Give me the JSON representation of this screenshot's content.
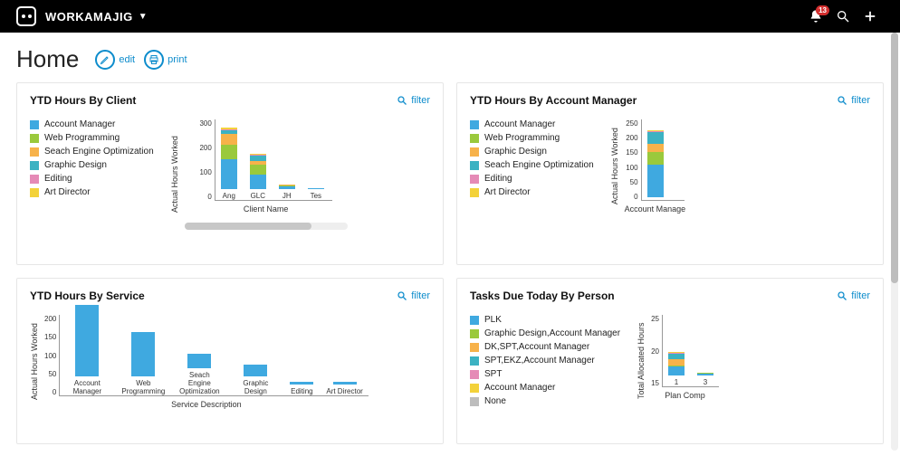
{
  "topbar": {
    "brand": "WORKAMAJIG",
    "notif_count": "13"
  },
  "page": {
    "title": "Home",
    "edit_label": "edit",
    "print_label": "print"
  },
  "filter_label": "filter",
  "colors": {
    "blue": "#3fa9e0",
    "green": "#9ac93c",
    "orange": "#f7b24a",
    "teal": "#3cb2c2",
    "pink": "#e58ab6",
    "yellow": "#f3d23a",
    "grey": "#bdbdbd"
  },
  "cards": {
    "ytd_client": {
      "title": "YTD Hours By Client",
      "y_title": "Actual Hours Worked",
      "x_title": "Client Name",
      "legend": [
        {
          "label": "Account Manager",
          "color": "blue"
        },
        {
          "label": "Web Programming",
          "color": "green"
        },
        {
          "label": "Seach Engine Optimization",
          "color": "orange"
        },
        {
          "label": "Graphic Design",
          "color": "teal"
        },
        {
          "label": "Editing",
          "color": "pink"
        },
        {
          "label": "Art Director",
          "color": "yellow"
        }
      ],
      "chart_data": {
        "type": "bar",
        "categories": [
          "Ang",
          "GLC",
          "JH",
          "Tes"
        ],
        "ylim": [
          0,
          300
        ],
        "ticks": [
          "300",
          "200",
          "100",
          "0"
        ],
        "series": [
          {
            "name": "Account Manager",
            "color": "blue",
            "values": [
              110,
              55,
              10,
              2
            ]
          },
          {
            "name": "Web Programming",
            "color": "green",
            "values": [
              55,
              35,
              5,
              0
            ]
          },
          {
            "name": "Seach Engine Optimization",
            "color": "orange",
            "values": [
              40,
              15,
              2,
              0
            ]
          },
          {
            "name": "Graphic Design",
            "color": "teal",
            "values": [
              12,
              20,
              0,
              0
            ]
          },
          {
            "name": "Editing",
            "color": "pink",
            "values": [
              2,
              2,
              0,
              0
            ]
          },
          {
            "name": "Art Director",
            "color": "yellow",
            "values": [
              8,
              2,
              0,
              0
            ]
          }
        ]
      }
    },
    "ytd_manager": {
      "title": "YTD Hours By Account Manager",
      "y_title": "Actual Hours Worked",
      "x_title": "Account Manage",
      "legend": [
        {
          "label": "Account Manager",
          "color": "blue"
        },
        {
          "label": "Web Programming",
          "color": "green"
        },
        {
          "label": "Graphic Design",
          "color": "orange"
        },
        {
          "label": "Seach Engine Optimization",
          "color": "teal"
        },
        {
          "label": "Editing",
          "color": "pink"
        },
        {
          "label": "Art Director",
          "color": "yellow"
        }
      ],
      "chart_data": {
        "type": "bar",
        "categories": [
          ""
        ],
        "ylim": [
          0,
          250
        ],
        "ticks": [
          "250",
          "200",
          "150",
          "100",
          "50",
          "0"
        ],
        "series": [
          {
            "name": "Account Manager",
            "color": "blue",
            "values": [
              100
            ]
          },
          {
            "name": "Web Programming",
            "color": "green",
            "values": [
              40
            ]
          },
          {
            "name": "Graphic Design",
            "color": "orange",
            "values": [
              25
            ]
          },
          {
            "name": "Seach Engine Optimization",
            "color": "teal",
            "values": [
              35
            ]
          },
          {
            "name": "Editing",
            "color": "pink",
            "values": [
              2
            ]
          },
          {
            "name": "Art Director",
            "color": "yellow",
            "values": [
              5
            ]
          }
        ]
      }
    },
    "ytd_service": {
      "title": "YTD Hours By Service",
      "y_title": "Actual Hours Worked",
      "x_title": "Service Description",
      "chart_data": {
        "type": "bar",
        "categories": [
          "Account Manager",
          "Web Programming",
          "Seach Engine Optimization",
          "Graphic Design",
          "Editing",
          "Art Director"
        ],
        "ylim": [
          0,
          200
        ],
        "ticks": [
          "200",
          "150",
          "100",
          "50",
          "0"
        ],
        "values": [
          175,
          108,
          35,
          30,
          6,
          6
        ]
      }
    },
    "tasks_due": {
      "title": "Tasks Due Today By Person",
      "y_title": "Total Allocated Hours",
      "x_title": "Plan Comp",
      "legend": [
        {
          "label": "PLK",
          "color": "blue"
        },
        {
          "label": "Graphic Design,Account Manager",
          "color": "green"
        },
        {
          "label": "DK,SPT,Account Manager",
          "color": "orange"
        },
        {
          "label": "SPT,EKZ,Account Manager",
          "color": "teal"
        },
        {
          "label": "SPT",
          "color": "pink"
        },
        {
          "label": "Account Manager",
          "color": "yellow"
        },
        {
          "label": "None",
          "color": "grey"
        }
      ],
      "chart_data": {
        "type": "bar",
        "categories": [
          "1",
          "3"
        ],
        "ylim": [
          0,
          25
        ],
        "ticks": [
          "25",
          "20",
          "15"
        ],
        "series": [
          {
            "name": "PLK",
            "color": "blue",
            "values": [
              3,
              0.5
            ]
          },
          {
            "name": "Graphic Design,Account Manager",
            "color": "green",
            "values": [
              0.5,
              0.3
            ]
          },
          {
            "name": "DK,SPT,Account Manager",
            "color": "orange",
            "values": [
              2,
              0.2
            ]
          },
          {
            "name": "SPT,EKZ,Account Manager",
            "color": "teal",
            "values": [
              2,
              0
            ]
          },
          {
            "name": "SPT",
            "color": "pink",
            "values": [
              0.3,
              0
            ]
          },
          {
            "name": "Account Manager",
            "color": "yellow",
            "values": [
              0.3,
              0
            ]
          },
          {
            "name": "None",
            "color": "grey",
            "values": [
              0,
              0
            ]
          }
        ]
      }
    }
  }
}
